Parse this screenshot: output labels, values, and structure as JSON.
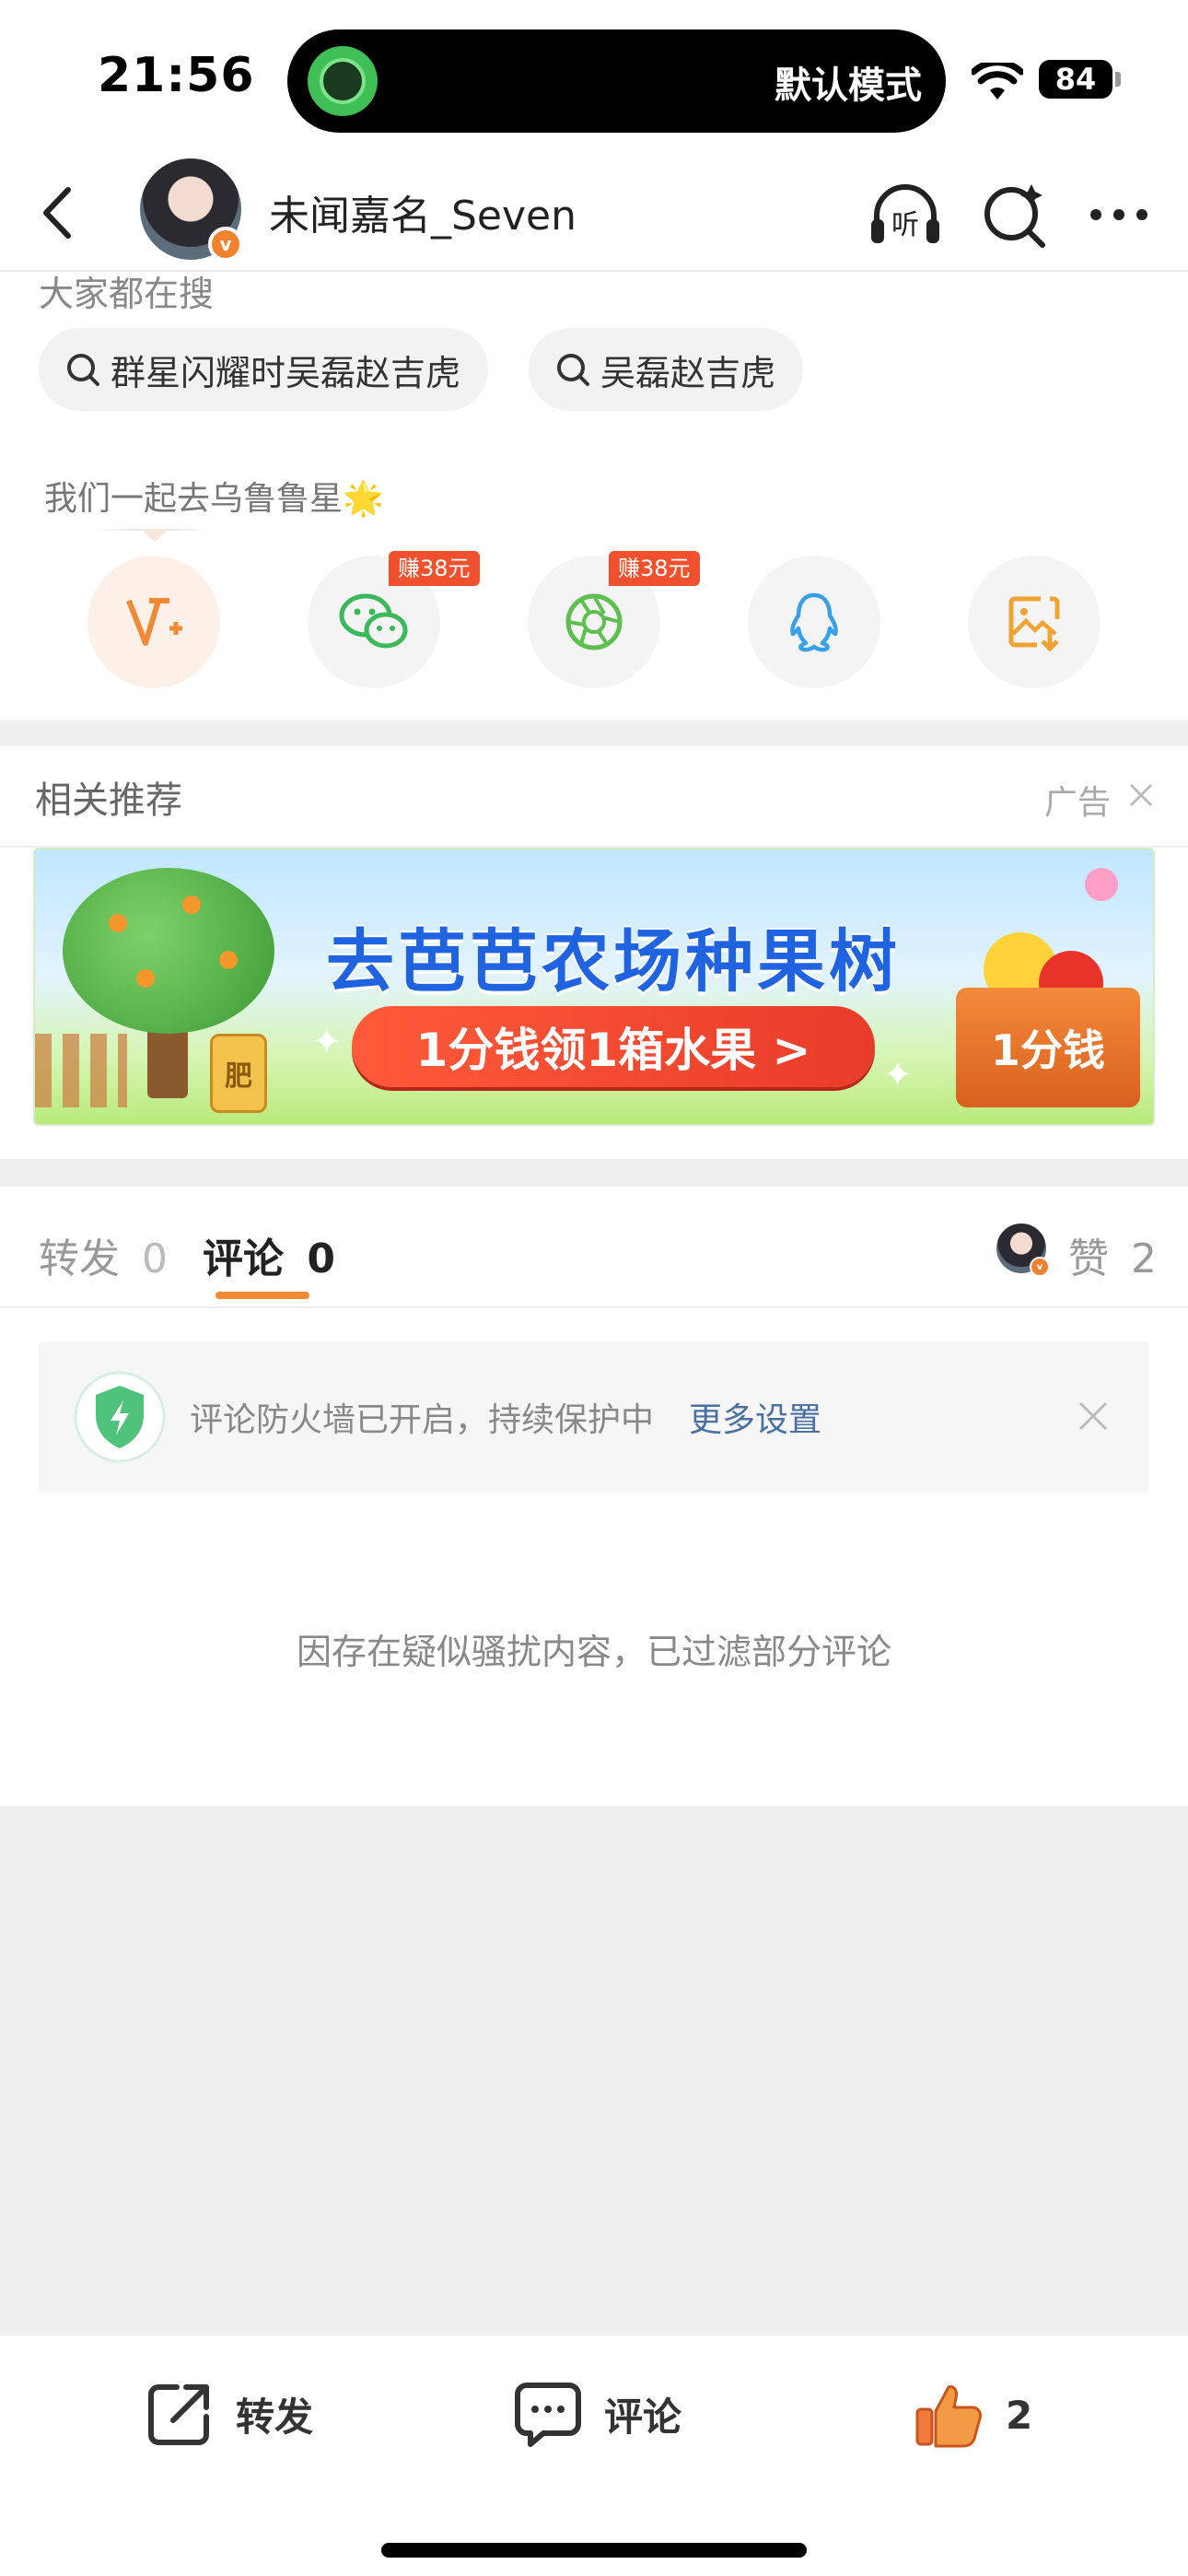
{
  "status": {
    "time": "21:56",
    "mode": "默认模式",
    "battery": "84"
  },
  "nav": {
    "username": "未闻嘉名_Seven",
    "listen_label": "听"
  },
  "search": {
    "heading": "大家都在搜",
    "chips": [
      "群星闪耀时吴磊赵吉虎",
      "吴磊赵吉虎"
    ]
  },
  "share": {
    "tip": "我们一起去乌鲁鲁星🌟",
    "earn_badge": "赚38元"
  },
  "recommend": {
    "title": "相关推荐",
    "ad_label": "广告",
    "banner_title": "去芭芭农场种果树",
    "banner_button": "1分钱领1箱水果 >",
    "banner_box": "1分钱",
    "fertilizer": "肥"
  },
  "tabs": {
    "repost_label": "转发",
    "repost_count": "0",
    "comment_label": "评论",
    "comment_count": "0",
    "like_label": "赞",
    "like_count": "2"
  },
  "firewall": {
    "text": "评论防火墙已开启，持续保护中",
    "link": "更多设置"
  },
  "filtered_notice": "因存在疑似骚扰内容，已过滤部分评论",
  "bottom_bar": {
    "repost": "转发",
    "comment": "评论",
    "like_count": "2"
  },
  "colors": {
    "accent_orange": "#f08a34",
    "link_blue": "#4a6fa1",
    "earn_red": "#f1502f"
  }
}
